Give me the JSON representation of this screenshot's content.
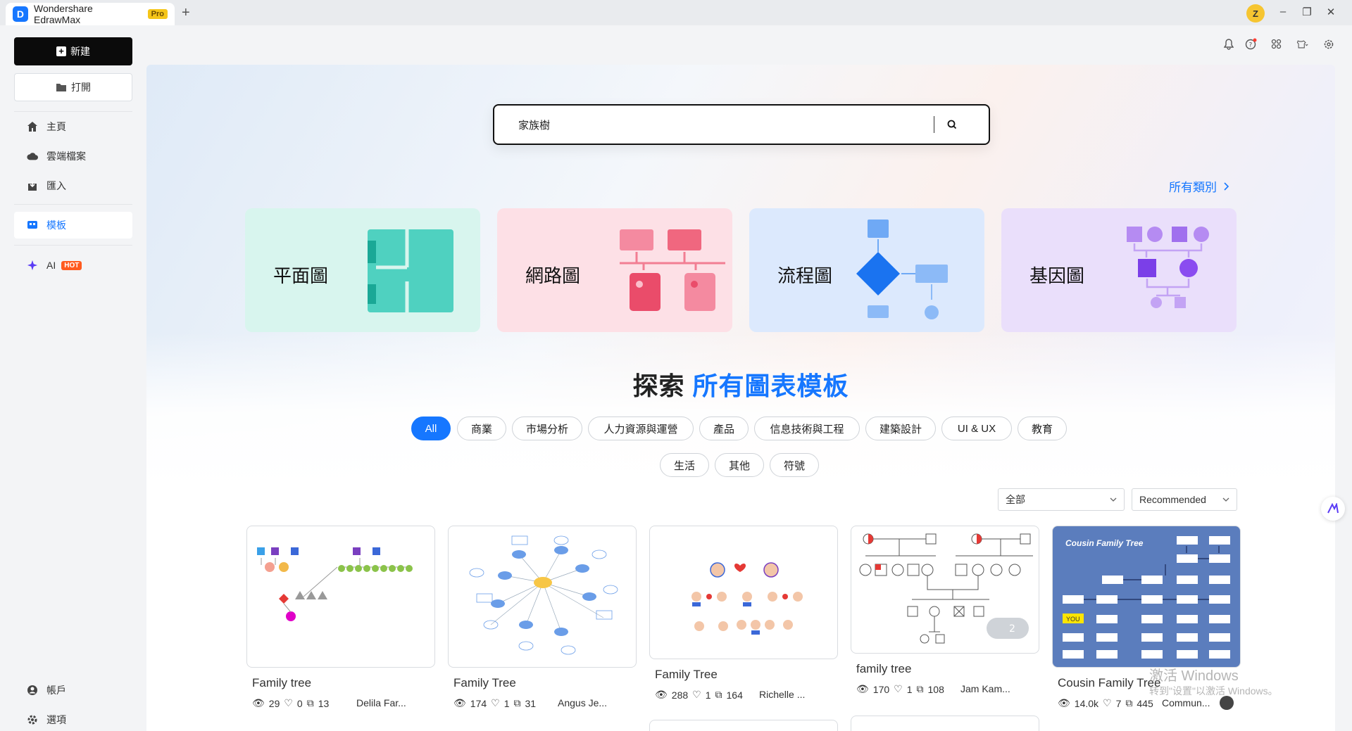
{
  "titlebar": {
    "app_title": "Wondershare EdrawMax",
    "pro_label": "Pro",
    "add_tab": "+",
    "user_initial": "Z",
    "minimize": "–",
    "restore": "❐",
    "close": "✕"
  },
  "sidebar": {
    "new_label": "新建",
    "open_label": "打開",
    "items": [
      {
        "label": "主頁",
        "icon": "home-icon"
      },
      {
        "label": "雲端檔案",
        "icon": "cloud-icon"
      },
      {
        "label": "匯入",
        "icon": "import-icon"
      },
      {
        "label": "模板",
        "icon": "template-icon"
      },
      {
        "label": "AI",
        "icon": "ai-sparkle-icon",
        "badge": "HOT"
      }
    ],
    "bottom_items": [
      {
        "label": "帳戶",
        "icon": "account-icon"
      },
      {
        "label": "選項",
        "icon": "gear-icon"
      }
    ]
  },
  "search": {
    "value": "家族樹"
  },
  "all_categories_label": "所有類別",
  "category_cards": [
    {
      "label": "平面圖",
      "bg": "#d8f5ee"
    },
    {
      "label": "網路圖",
      "bg": "#fde0e6"
    },
    {
      "label": "流程圖",
      "bg": "#dce9fd"
    },
    {
      "label": "基因圖",
      "bg": "#eadffb"
    }
  ],
  "explore": {
    "prefix": "探索",
    "highlight": "所有圖表模板"
  },
  "chips_row1": [
    "All",
    "商業",
    "市場分析",
    "人力資源與運營",
    "產品",
    "信息技術與工程",
    "建築設計",
    "UI & UX",
    "教育"
  ],
  "chips_row2": [
    "生活",
    "其他",
    "符號"
  ],
  "filters": {
    "scope": "全部",
    "sort": "Recommended"
  },
  "templates": [
    {
      "title": "Family tree",
      "views": "29",
      "likes": "0",
      "copies": "13",
      "author": "Delila Far..."
    },
    {
      "title": "Family Tree",
      "views": "174",
      "likes": "1",
      "copies": "31",
      "author": "Angus Je..."
    },
    {
      "title": "Family Tree",
      "views": "288",
      "likes": "1",
      "copies": "164",
      "author": "Richelle ..."
    },
    {
      "title": "family tree",
      "views": "170",
      "likes": "1",
      "copies": "108",
      "author": "Jam Kam...",
      "pages": "2"
    },
    {
      "title": "Cousin Family Tree",
      "views": "14.0k",
      "likes": "7",
      "copies": "445",
      "author": "Commun...",
      "thumb_title": "Cousin Family Tree",
      "thumb_you": "YOU"
    }
  ],
  "watermark": {
    "line1": "激活 Windows",
    "line2": "转到\"设置\"以激活 Windows。"
  },
  "colors": {
    "accent": "#1677ff",
    "hot": "#ff5a1f"
  }
}
